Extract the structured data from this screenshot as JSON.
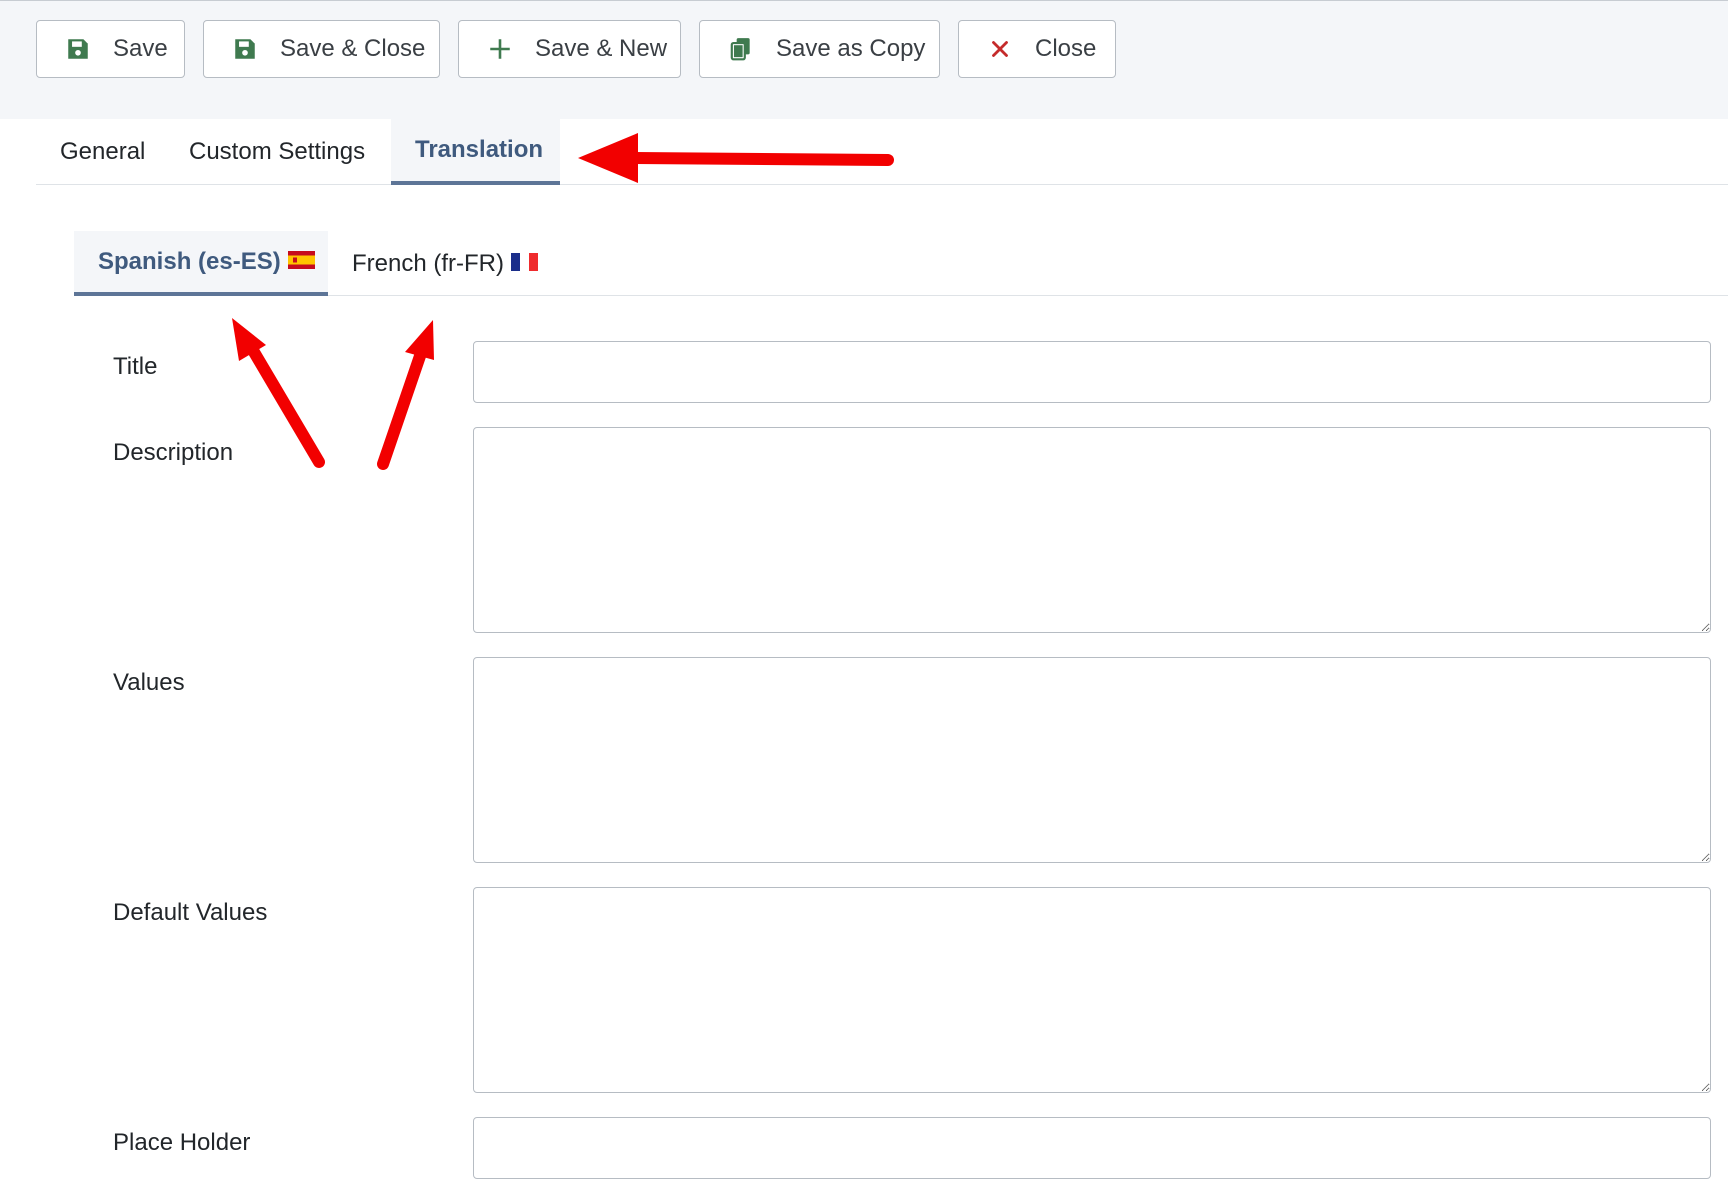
{
  "toolbar": {
    "buttons": [
      {
        "label": "Save",
        "icon": "floppy-disk-icon"
      },
      {
        "label": "Save & Close",
        "icon": "floppy-disk-icon"
      },
      {
        "label": "Save & New",
        "icon": "plus-icon"
      },
      {
        "label": "Save as Copy",
        "icon": "copy-icon"
      },
      {
        "label": "Close",
        "icon": "close-x-icon"
      }
    ]
  },
  "tabs": [
    {
      "label": "General",
      "active": false
    },
    {
      "label": "Custom Settings",
      "active": false
    },
    {
      "label": "Translation",
      "active": true
    }
  ],
  "language_tabs": [
    {
      "label": "Spanish (es-ES)",
      "flag": "spain-flag-icon",
      "active": true
    },
    {
      "label": "French (fr-FR)",
      "flag": "france-flag-icon",
      "active": false
    }
  ],
  "form": {
    "title": {
      "label": "Title",
      "value": ""
    },
    "description": {
      "label": "Description",
      "value": ""
    },
    "values": {
      "label": "Values",
      "value": ""
    },
    "default_values": {
      "label": "Default Values",
      "value": ""
    },
    "place_holder": {
      "label": "Place Holder",
      "value": ""
    }
  },
  "colors": {
    "save_icon": "#3f7a4f",
    "close_icon": "#c52b2b",
    "active_tab_text": "#3f5a7e",
    "annotation_arrow": "#f20000"
  }
}
